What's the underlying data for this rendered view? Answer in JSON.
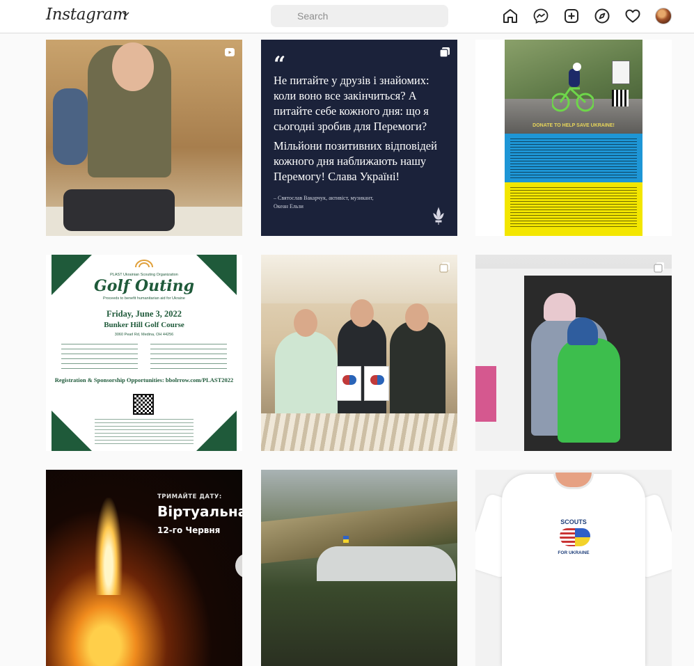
{
  "app": {
    "logo_text": "Instagram",
    "search_placeholder": "Search"
  },
  "nav_icons": [
    "home-icon",
    "messenger-icon",
    "new-post-icon",
    "explore-icon",
    "activity-heart-icon",
    "profile-avatar"
  ],
  "posts": [
    {
      "id": "scout-packing",
      "type": "reel",
      "icon": "reel-icon"
    },
    {
      "id": "quote",
      "type": "carousel",
      "icon": "carousel-icon",
      "quote_mark": "“",
      "paragraph_1": "Не питайте у друзів і знайомих: коли воно все закінчиться? А питайте себе кожного дня: що я сьогодні зробив для Перемоги?",
      "paragraph_2": "Мільйони позитивних відповідей кожного дня наближають нашу Перемогу! Слава Україні!",
      "author": "– Святослав Вакарчук, активіст, музикант, Океан Ельзи"
    },
    {
      "id": "cycling-flyer",
      "type": "image",
      "headline": "DONATE TO HELP SAVE UKRAINE!"
    },
    {
      "id": "golf-outing",
      "type": "image",
      "org_line": "PLAST Ukrainian Scouting Organization",
      "title": "Golf Outing",
      "subtitle": "Proceeds to benefit humanitarian aid for Ukraine",
      "date": "Friday, June 3, 2022",
      "course": "Bunker Hill Golf Course",
      "address": "3060 Pearl Rd, Medina, OH 44256",
      "registration": "Registration & Sponsorship Opportunities: bbolrrow.com/PLAST2022"
    },
    {
      "id": "scouts-with-flyers",
      "type": "carousel",
      "icon": "carousel-icon"
    },
    {
      "id": "family-in-car",
      "type": "carousel",
      "icon": "carousel-icon"
    },
    {
      "id": "bonfire-event",
      "type": "image",
      "tag": "ТРИМАЙТЕ ДАТУ:",
      "headline": "Віртуальна",
      "date": "12-го Червня"
    },
    {
      "id": "mountain-view",
      "type": "image"
    },
    {
      "id": "tshirt",
      "type": "image",
      "logo_top": "SCOUTS",
      "logo_bottom": "FOR UKRAINE"
    }
  ],
  "colors": {
    "golf_green": "#1f5a3a",
    "quote_navy": "#1b223a",
    "ukraine_blue": "#1e96d6",
    "ukraine_yellow": "#f3e600"
  }
}
